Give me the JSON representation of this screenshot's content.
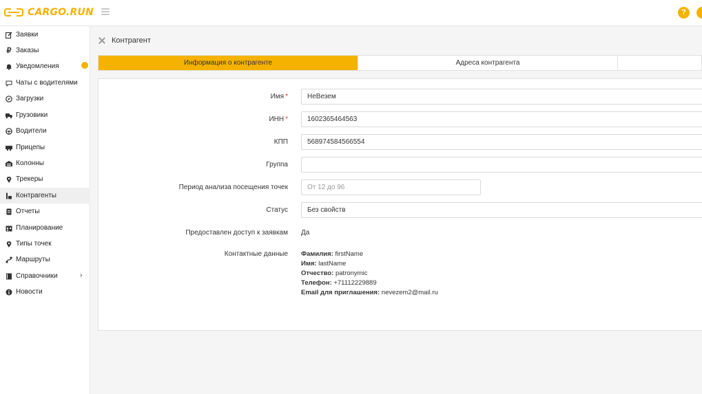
{
  "app": {
    "logo_text": "CARGO.RUN"
  },
  "header": {
    "help_icon_glyph": "?",
    "user_icon_glyph": ""
  },
  "colors": {
    "accent": "#f5b200",
    "required": "#e53935"
  },
  "sidebar": {
    "items": [
      {
        "label": "Заявки",
        "icon": "edit-icon"
      },
      {
        "label": "Заказы",
        "icon": "ruble-icon"
      },
      {
        "label": "Уведомления",
        "icon": "bell-icon",
        "badge": ""
      },
      {
        "label": "Чаты с водителями",
        "icon": "chat-icon"
      },
      {
        "label": "Загрузки",
        "icon": "compass-icon"
      },
      {
        "label": "Грузовики",
        "icon": "truck-icon"
      },
      {
        "label": "Водители",
        "icon": "steering-wheel-icon"
      },
      {
        "label": "Прицепы",
        "icon": "trailer-icon"
      },
      {
        "label": "Колонны",
        "icon": "warehouse-icon"
      },
      {
        "label": "Трекеры",
        "icon": "map-marker-icon"
      },
      {
        "label": "Контрагенты",
        "icon": "contractor-icon",
        "active": true
      },
      {
        "label": "Отчеты",
        "icon": "report-icon"
      },
      {
        "label": "Планирование",
        "icon": "calendar-icon"
      },
      {
        "label": "Типы точек",
        "icon": "map-marker-icon"
      },
      {
        "label": "Маршруты",
        "icon": "route-icon"
      },
      {
        "label": "Справочники",
        "icon": "book-icon",
        "has_submenu": true
      },
      {
        "label": "Новости",
        "icon": "info-icon"
      }
    ]
  },
  "page": {
    "title": "Контрагент",
    "tabs": [
      {
        "label": "Информация о контрагенте",
        "active": true
      },
      {
        "label": "Адреса контрагента",
        "active": false
      },
      {
        "label": "",
        "active": false
      }
    ]
  },
  "form": {
    "name": {
      "label": "Имя",
      "required_mark": "*",
      "value": "НеВезем"
    },
    "inn": {
      "label": "ИНН",
      "required_mark": "*",
      "value": "1602365464563"
    },
    "kpp": {
      "label": "КПП",
      "value": "568974584566554"
    },
    "group": {
      "label": "Группа",
      "value": ""
    },
    "period": {
      "label": "Период анализа посещения точек",
      "placeholder": "От 12 до 96"
    },
    "status": {
      "label": "Статус",
      "value": "Без свойств"
    },
    "access": {
      "label": "Предоставлен доступ к заявкам",
      "value": "Да"
    },
    "contacts": {
      "label": "Контактные данные",
      "lines": [
        {
          "key": "Фамилия:",
          "value": "firstName"
        },
        {
          "key": "Имя:",
          "value": "lastName"
        },
        {
          "key": "Отчество:",
          "value": "patronymic"
        },
        {
          "key": "Телефон:",
          "value": "+71112229889"
        },
        {
          "key": "Email для приглашения:",
          "value": "nevezem2@mail.ru"
        }
      ]
    }
  }
}
